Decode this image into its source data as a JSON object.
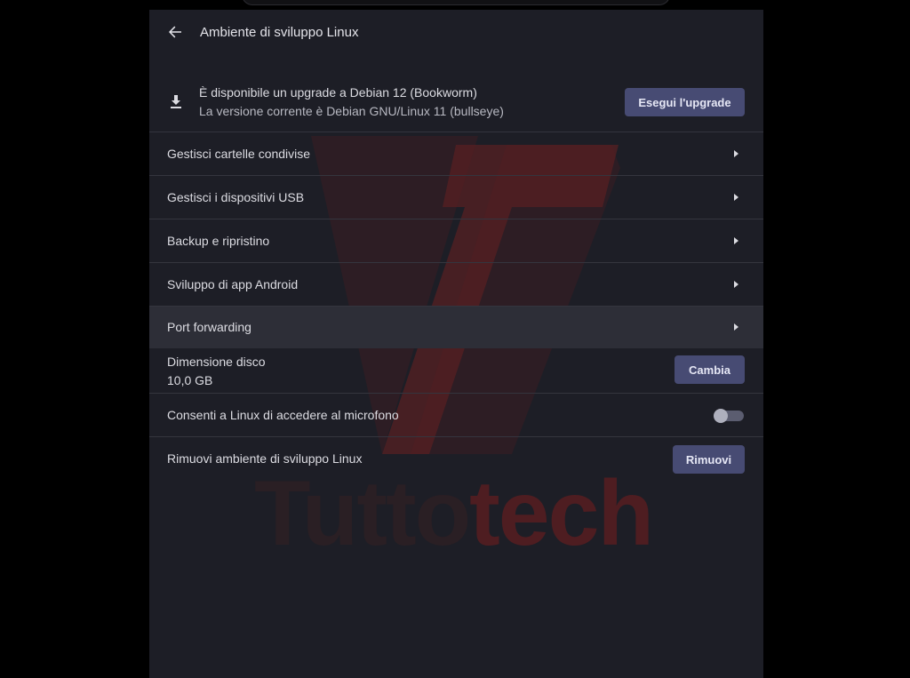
{
  "header": {
    "title": "Ambiente di sviluppo Linux",
    "back_icon": "arrow-left-icon"
  },
  "upgrade": {
    "icon": "download-icon",
    "title": "È disponibile un upgrade a Debian 12 (Bookworm)",
    "subtitle": "La versione corrente è Debian GNU/Linux 11 (bullseye)",
    "button_label": "Esegui l'upgrade"
  },
  "menu": {
    "shared_folders": "Gestisci cartelle condivise",
    "usb_devices": "Gestisci i dispositivi USB",
    "backup_restore": "Backup e ripristino",
    "android_dev": "Sviluppo di app Android",
    "port_forwarding": "Port forwarding"
  },
  "disk": {
    "label": "Dimensione disco",
    "value": "10,0 GB",
    "button_label": "Cambia"
  },
  "microphone": {
    "label": "Consenti a Linux di accedere al microfono",
    "enabled": false
  },
  "remove": {
    "label": "Rimuovi ambiente di sviluppo Linux",
    "button_label": "Rimuovi"
  },
  "watermark": {
    "text_part1": "Tutto",
    "text_part2": "tech"
  },
  "colors": {
    "panel_bg": "#1d1e26",
    "button_bg": "#474b73",
    "watermark_red": "#5a1f22"
  }
}
